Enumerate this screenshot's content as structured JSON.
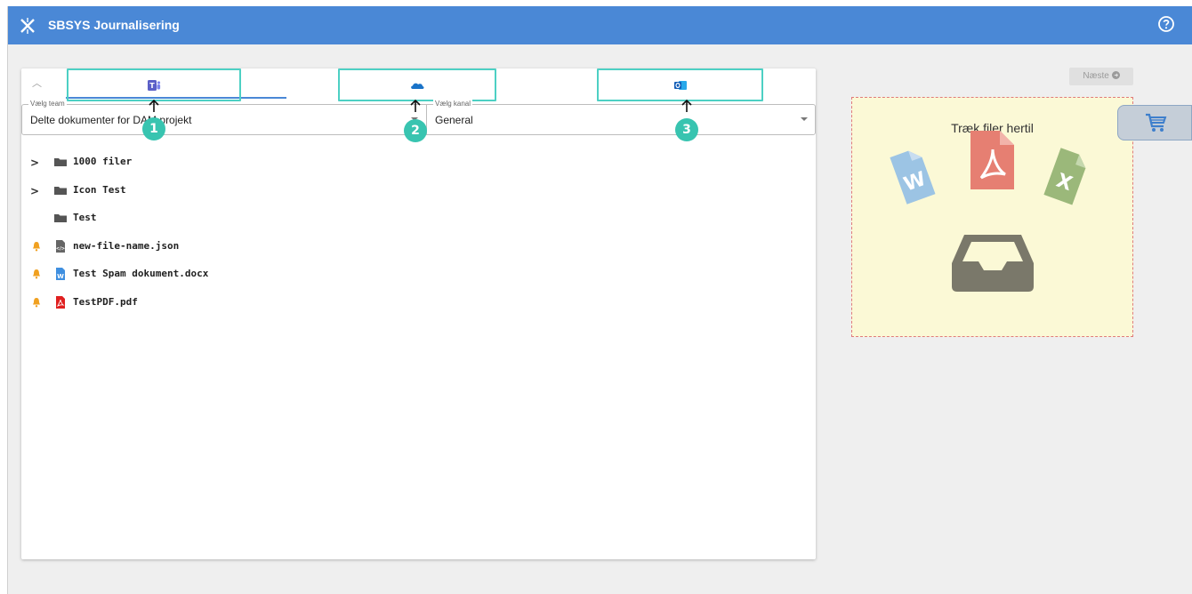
{
  "app": {
    "title": "SBSYS Journalisering"
  },
  "tabs": [
    {
      "name": "teams",
      "icon": "teams-icon"
    },
    {
      "name": "onedrive",
      "icon": "onedrive-icon"
    },
    {
      "name": "outlook",
      "icon": "outlook-icon"
    }
  ],
  "badges": [
    "1",
    "2",
    "3"
  ],
  "team_select": {
    "legend": "Vælg team",
    "value": "Delte dokumenter for DAM projekt"
  },
  "channel_select": {
    "legend": "Vælg kanal",
    "value": "General"
  },
  "tree": [
    {
      "label": "1000 filer",
      "type": "folder",
      "expandable": true,
      "alert": false
    },
    {
      "label": "Icon Test",
      "type": "folder",
      "expandable": true,
      "alert": false
    },
    {
      "label": "Test",
      "type": "folder",
      "expandable": false,
      "alert": false
    },
    {
      "label": "new-file-name.json",
      "type": "json",
      "expandable": false,
      "alert": true
    },
    {
      "label": "Test Spam dokument.docx",
      "type": "word",
      "expandable": false,
      "alert": true
    },
    {
      "label": "TestPDF.pdf",
      "type": "pdf",
      "expandable": false,
      "alert": true
    }
  ],
  "next_button": {
    "label": "Næste"
  },
  "dropzone": {
    "title": "Træk filer hertil"
  },
  "colors": {
    "header": "#4a88d6",
    "tab_highlight": "#4dd0c4",
    "badge": "#38c4b0",
    "dropzone_bg": "#fbf9d6"
  }
}
